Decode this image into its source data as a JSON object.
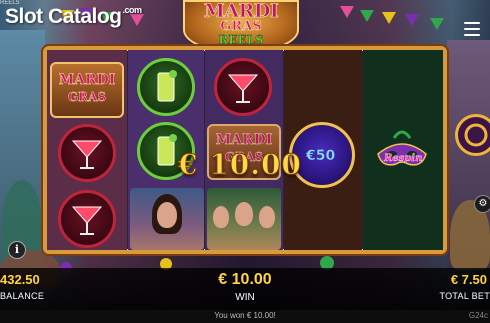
{
  "header": {
    "watermark_main": "Slot Catalog",
    "watermark_suffix": ".com",
    "corner_text": "REELS"
  },
  "logo": {
    "line1": "MARDI",
    "line2": "GRAS",
    "line3": "REELS"
  },
  "reels": {
    "mardi_symbol_line1": "MARDI",
    "mardi_symbol_line2": "GRAS",
    "coin_value": "€50",
    "respin_label": "Respin"
  },
  "win_overlay": "€ 10.00",
  "info_button": "i",
  "bottom_bar": {
    "balance_value": "432.50",
    "balance_label": "BALANCE",
    "win_value": "€ 10.00",
    "win_label": "WIN",
    "total_bet_value": "€ 7.50",
    "total_bet_label": "TOTAL BET"
  },
  "footer": {
    "message": "You won € 10.00!",
    "game_id": "G24c"
  },
  "colors": {
    "frame": "#d89a3b",
    "accent_gold": "#ffd340",
    "martini_ring": "#c0243a",
    "highball_ring": "#6ccf3a"
  },
  "icons": [
    "menu-icon",
    "spin-icon",
    "autoplay-icon",
    "info-icon",
    "martini-icon",
    "highball-icon",
    "mask-icon"
  ]
}
